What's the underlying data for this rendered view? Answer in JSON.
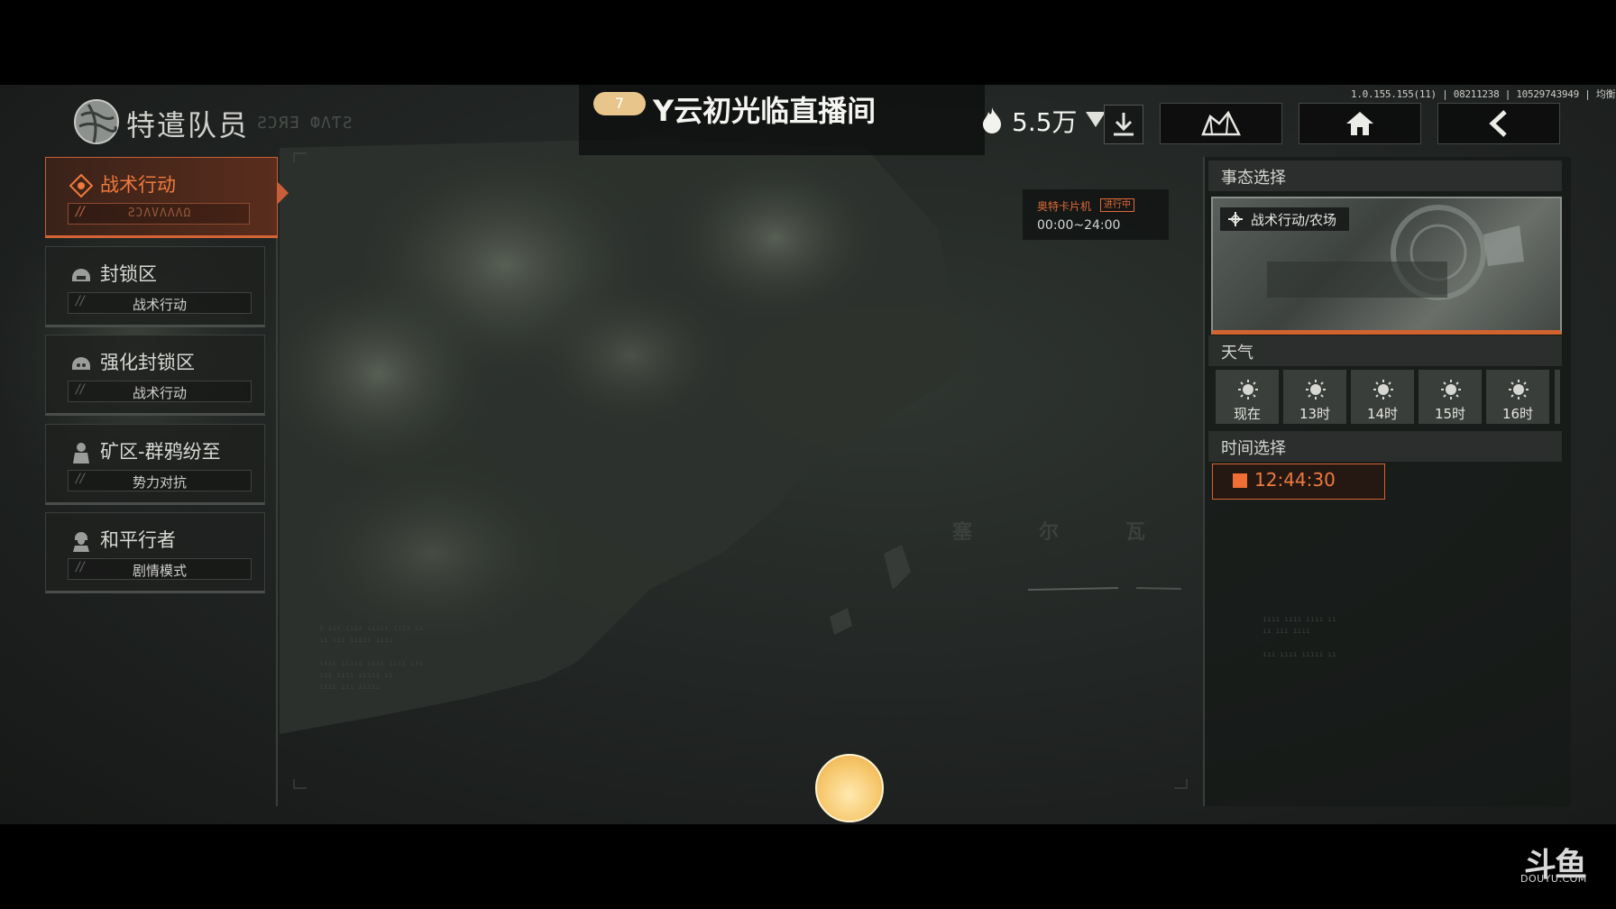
{
  "header": {
    "page_title": "特遣队员",
    "page_subtitle_deco": "ƧƆЯƎ ՓΛƬƧ",
    "version": "1.0.155.155(11) | 08211238 | 10529743949 | 均衡"
  },
  "stream": {
    "level": "7",
    "title": "Y云初光临直播间",
    "hot_count": "5.5万"
  },
  "nav": [
    "map-icon",
    "home-icon",
    "back-icon"
  ],
  "modes": [
    {
      "title": "战术行动",
      "sub": "ƧƆΛVΛΛΛΩ",
      "icon": "tactical-icon",
      "active": true
    },
    {
      "title": "封锁区",
      "sub": "战术行动",
      "icon": "helmet-icon",
      "active": false
    },
    {
      "title": "强化封锁区",
      "sub": "战术行动",
      "icon": "helmet-skull-icon",
      "active": false
    },
    {
      "title": "矿区-群鸦纷至",
      "sub": "势力对抗",
      "icon": "soldier-icon",
      "active": false
    },
    {
      "title": "和平行者",
      "sub": "剧情模式",
      "icon": "soldier-helmet-icon",
      "active": false
    }
  ],
  "event": {
    "name": "奥特卡片机",
    "status": "进行中",
    "time": "00:00~24:00"
  },
  "map_labels": [
    "塞",
    "尔",
    "瓦"
  ],
  "right_panel": {
    "situation_title": "事态选择",
    "situation_tag": "战术行动/农场",
    "weather_title": "天气",
    "weather_slots": [
      "现在",
      "13时",
      "14时",
      "15时",
      "16时"
    ],
    "time_title": "时间选择",
    "time_value": "12:44:30"
  },
  "watermark": {
    "cn": "斗鱼",
    "en": "DOUYU.COM"
  },
  "colors": {
    "accent": "#e06a38",
    "active_bg": "#5a2d1c",
    "panel_bg": "#232725"
  }
}
